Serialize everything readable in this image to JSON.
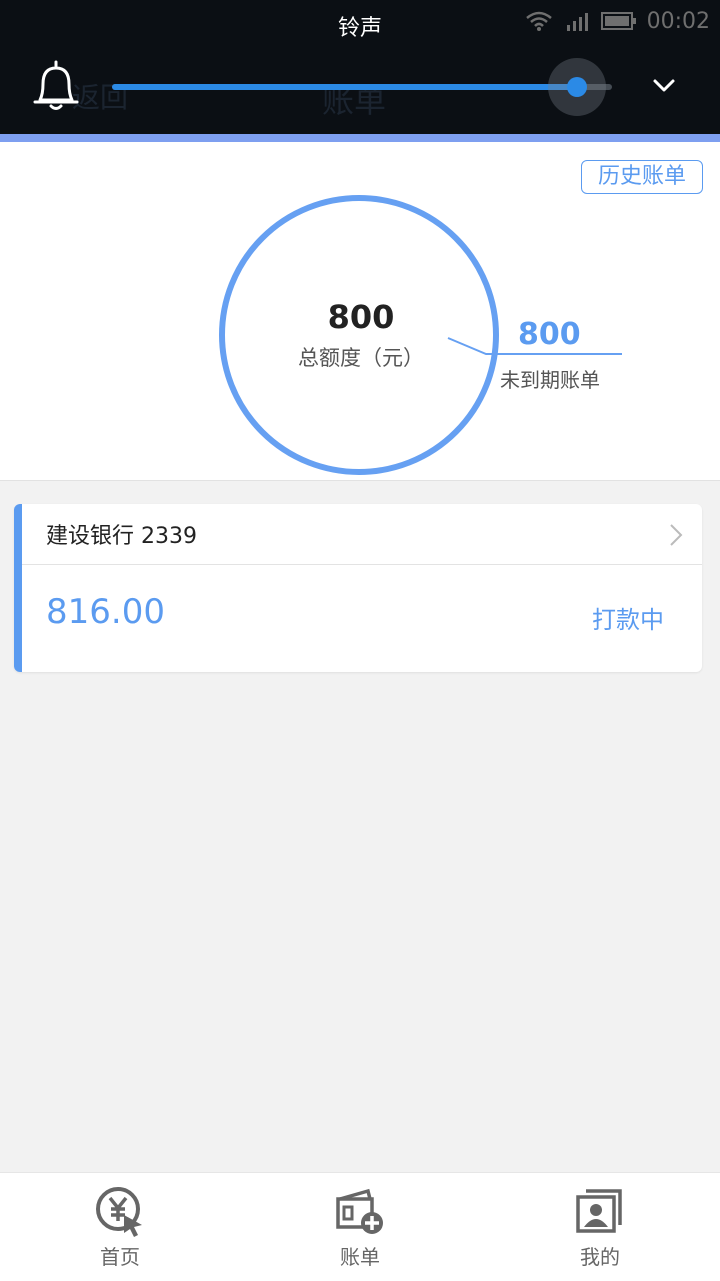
{
  "volume_overlay": {
    "title": "铃声",
    "level": 0.93,
    "time": "00:02"
  },
  "header": {
    "back_label": "返回",
    "title": "账单"
  },
  "summary": {
    "history_button": "历史账单",
    "total_value": "800",
    "total_label": "总额度（元）",
    "pending_value": "800",
    "pending_label": "未到期账单"
  },
  "bill_card": {
    "bank": "建设银行 2339",
    "amount": "816.00",
    "status": "打款中"
  },
  "tabbar": {
    "items": [
      {
        "label": "首页",
        "icon": "yuan-cursor-icon"
      },
      {
        "label": "账单",
        "icon": "wallet-plus-icon"
      },
      {
        "label": "我的",
        "icon": "profile-card-icon"
      }
    ]
  },
  "colors": {
    "accent": "#5b9bf0",
    "slider": "#2b8ae6",
    "overlay_bg": "#0b0f14"
  }
}
